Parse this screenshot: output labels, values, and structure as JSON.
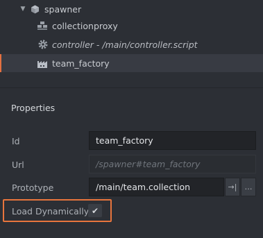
{
  "outline": {
    "items": [
      {
        "label": "spawner",
        "icon": "game-object-cube-icon",
        "expanded": true
      },
      {
        "label": "collectionproxy",
        "icon": "collection-proxy-icon"
      },
      {
        "label": "controller - /main/controller.script",
        "icon": "script-gear-icon"
      },
      {
        "label": "team_factory",
        "icon": "factory-icon",
        "selected": true
      }
    ]
  },
  "properties": {
    "title": "Properties",
    "id": {
      "label": "Id",
      "value": "team_factory"
    },
    "url": {
      "label": "Url",
      "value": "/spawner#team_factory"
    },
    "prototype": {
      "label": "Prototype",
      "value": "/main/team.collection",
      "goto_glyph": "→|",
      "browse_glyph": "…"
    },
    "load_dynamically": {
      "label": "Load Dynamically",
      "checked": true,
      "check_glyph": "✔"
    }
  },
  "colors": {
    "background": "#2c2f35",
    "selection_accent": "#e47040",
    "highlight_border": "#e8753d"
  }
}
